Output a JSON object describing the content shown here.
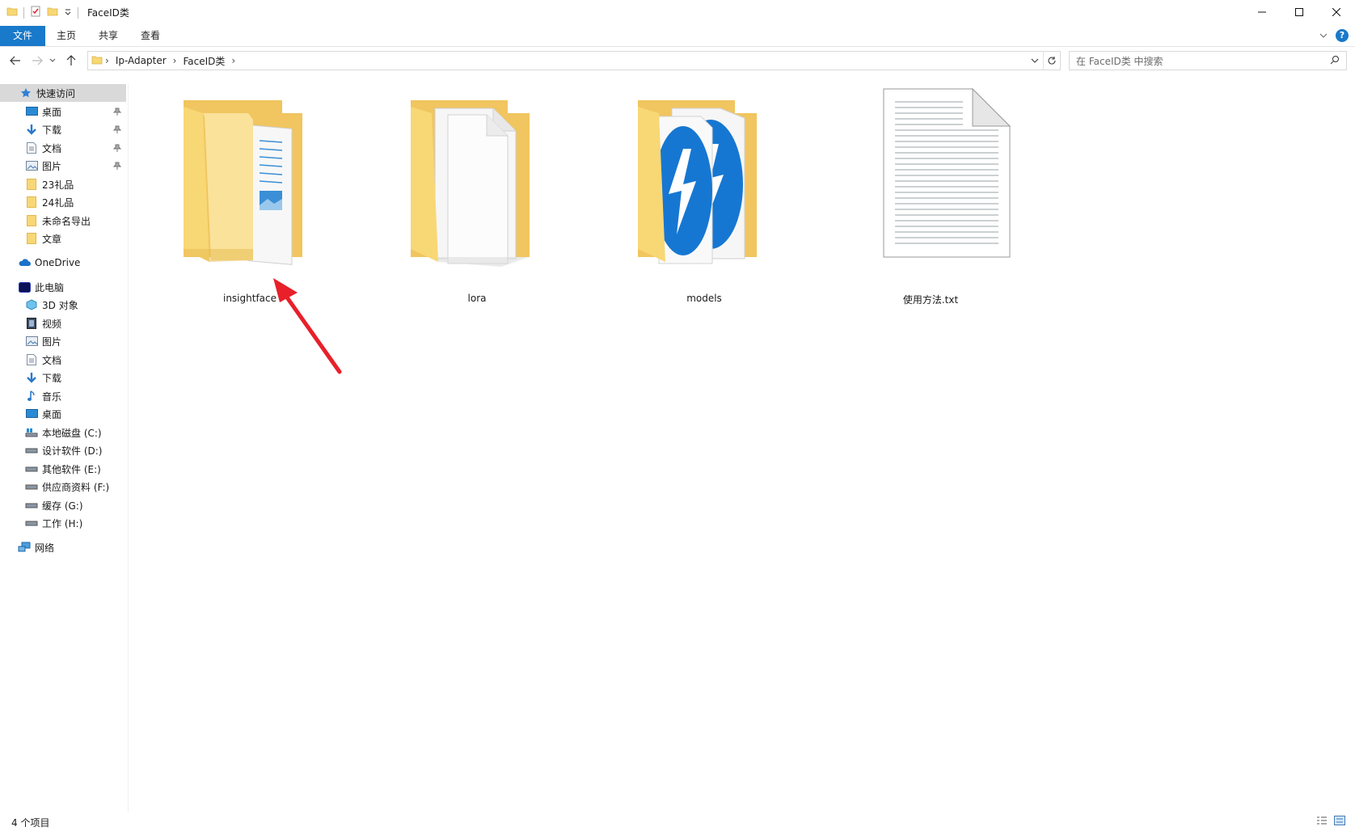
{
  "window": {
    "title": "FaceID类"
  },
  "ribbon": {
    "tabs": [
      "文件",
      "主页",
      "共享",
      "查看"
    ]
  },
  "address": {
    "crumbs": [
      "Ip-Adapter",
      "FaceID类"
    ]
  },
  "search": {
    "placeholder": "在 FaceID类 中搜索"
  },
  "sidebar": {
    "quick_access": "快速访问",
    "quick_items": [
      {
        "label": "桌面",
        "pinned": true
      },
      {
        "label": "下载",
        "pinned": true
      },
      {
        "label": "文档",
        "pinned": true
      },
      {
        "label": "图片",
        "pinned": true
      },
      {
        "label": "23礼品",
        "pinned": false
      },
      {
        "label": "24礼品",
        "pinned": false
      },
      {
        "label": "未命名导出",
        "pinned": false
      },
      {
        "label": "文章",
        "pinned": false
      }
    ],
    "onedrive": "OneDrive",
    "this_pc": "此电脑",
    "pc_items": [
      "3D 对象",
      "视频",
      "图片",
      "文档",
      "下载",
      "音乐",
      "桌面",
      "本地磁盘 (C:)",
      "设计软件 (D:)",
      "其他软件 (E:)",
      "供应商资料 (F:)",
      "缓存 (G:)",
      "工作 (H:)"
    ],
    "network": "网络"
  },
  "files": [
    {
      "name": "insightface",
      "type": "folder-docs"
    },
    {
      "name": "lora",
      "type": "folder-files"
    },
    {
      "name": "models",
      "type": "folder-app"
    },
    {
      "name": "使用方法.txt",
      "type": "text-file"
    }
  ],
  "status": {
    "count": "4 个项目"
  },
  "colors": {
    "accent": "#1979ca",
    "folder": "#f8d775",
    "annotation_arrow": "#e8202a"
  }
}
